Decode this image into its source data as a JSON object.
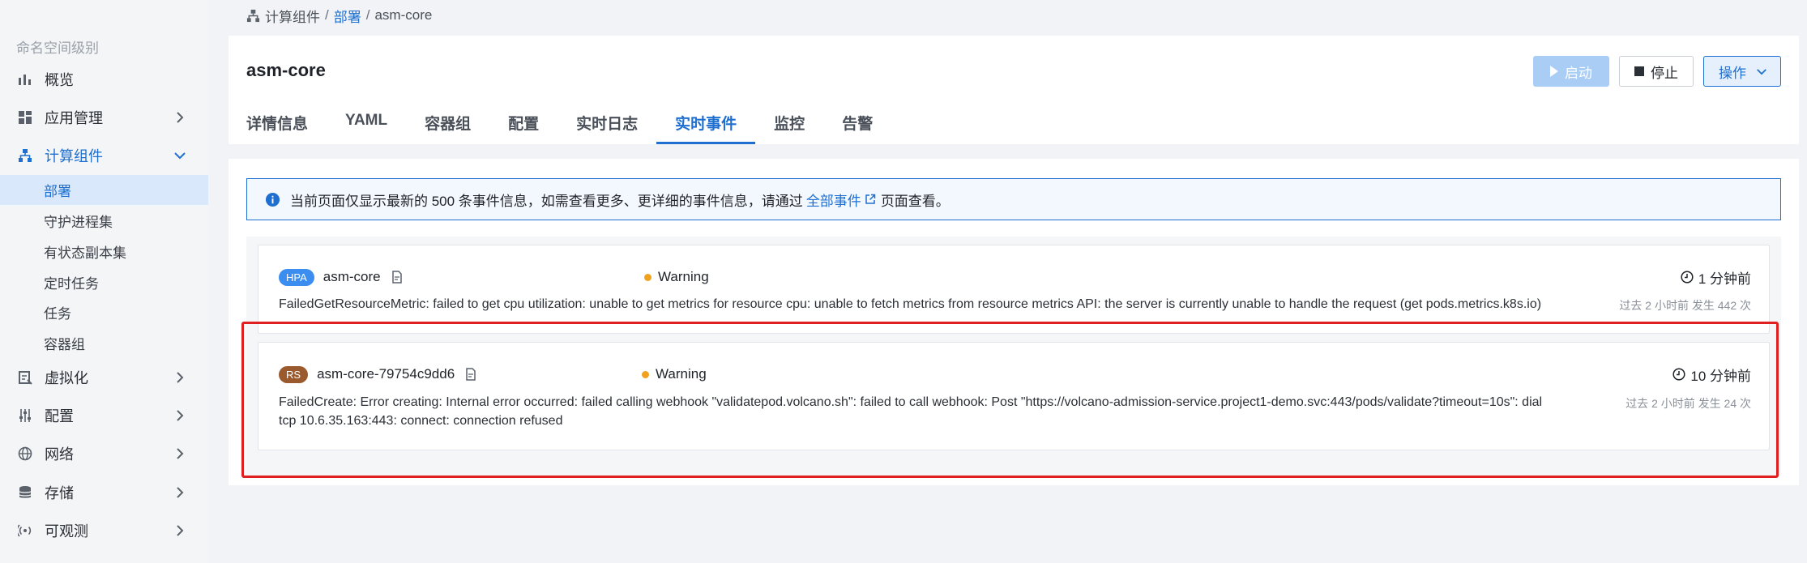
{
  "sidebar": {
    "namespace_level": "命名空间级别",
    "items": [
      {
        "label": "概览"
      },
      {
        "label": "应用管理"
      },
      {
        "label": "计算组件"
      },
      {
        "label": "虚拟化"
      },
      {
        "label": "配置"
      },
      {
        "label": "网络"
      },
      {
        "label": "存储"
      },
      {
        "label": "可观测"
      }
    ],
    "compute_sub": [
      {
        "label": "部署"
      },
      {
        "label": "守护进程集"
      },
      {
        "label": "有状态副本集"
      },
      {
        "label": "定时任务"
      },
      {
        "label": "任务"
      },
      {
        "label": "容器组"
      }
    ]
  },
  "breadcrumb": {
    "root": "计算组件",
    "section": "部署",
    "current": "asm-core",
    "separator": "/"
  },
  "header": {
    "title": "asm-core",
    "start_label": "启动",
    "stop_label": "停止",
    "ops_label": "操作"
  },
  "tabs": [
    {
      "label": "详情信息"
    },
    {
      "label": "YAML"
    },
    {
      "label": "容器组"
    },
    {
      "label": "配置"
    },
    {
      "label": "实时日志"
    },
    {
      "label": "实时事件"
    },
    {
      "label": "监控"
    },
    {
      "label": "告警"
    }
  ],
  "banner": {
    "text_before": "当前页面仅显示最新的 500 条事件信息，如需查看更多、更详细的事件信息，请通过",
    "link": "全部事件",
    "text_after": "页面查看。"
  },
  "events": [
    {
      "kind": "HPA",
      "name": "asm-core",
      "status": "Warning",
      "time": "1 分钟前",
      "message": "FailedGetResourceMetric: failed to get cpu utilization: unable to get metrics for resource cpu: unable to fetch metrics from resource metrics API: the server is currently unable to handle the request (get pods.metrics.k8s.io)",
      "meta": "过去 2 小时前 发生 442 次"
    },
    {
      "kind": "RS",
      "name": "asm-core-79754c9dd6",
      "status": "Warning",
      "time": "10 分钟前",
      "message_line1": "FailedCreate: Error creating: Internal error occurred: failed calling webhook \"validatepod.volcano.sh\": failed to call webhook: Post \"https://volcano-admission-service.project1-demo.svc:443/pods/validate?timeout=10s\": dial",
      "message_line2": "tcp 10.6.35.163:443: connect: connection refused",
      "meta": "过去 2 小时前 发生 24 次"
    }
  ],
  "colors": {
    "accent": "#1e6fd0",
    "warning": "#f0a11f",
    "highlight": "#e02020",
    "hpa_badge": "#3b8df0",
    "rs_badge": "#9a5a2e"
  }
}
